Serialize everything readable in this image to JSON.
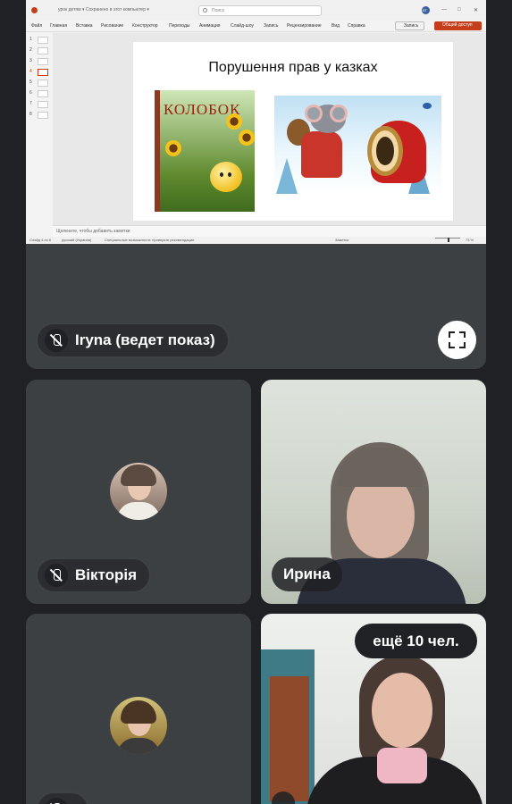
{
  "presentation": {
    "doc_title": "урок детям ▾ Сохранено в этот компьютер ▾",
    "search_placeholder": "Поиск",
    "avatar_initials": "ВТ",
    "window_controls": [
      "—",
      "□",
      "✕"
    ],
    "ribbon_tabs": [
      "Файл",
      "Главная",
      "Вставка",
      "Рисование",
      "Конструктор",
      "Переходы",
      "Анимация",
      "Слайд-шоу",
      "Запись",
      "Рецензирование",
      "Вид",
      "Справка"
    ],
    "record_label": "Запись",
    "share_label": "Общий доступ",
    "slide_numbers": [
      "1",
      "2",
      "3",
      "4",
      "5",
      "6",
      "7",
      "8"
    ],
    "active_slide_index": 3,
    "slide_title": "Порушення прав у казках",
    "book_title": "КОЛОБОК",
    "notes_placeholder": "Щелкните, чтобы добавить заметки",
    "status": {
      "slide_counter": "Слайд 4 из 8",
      "language": "русский (Украина)",
      "accessibility": "Специальные возможности: проверьте рекомендации",
      "notes_button": "Заметки",
      "zoom": "73 %"
    }
  },
  "tiles": {
    "presenter": {
      "label": "Iryna (ведет показ)"
    },
    "participant_1": {
      "name": "Вікторія"
    },
    "participant_2": {
      "name": "Ирина"
    },
    "participant_3": {
      "name": ""
    },
    "participant_4": {
      "name": ""
    },
    "more_participants": "ещё 10 чел."
  },
  "icons": {
    "mic_muted": "mic-off-icon",
    "fullscreen": "fullscreen-icon"
  },
  "colors": {
    "background": "#202124",
    "tile": "#3c4043",
    "powerpoint_accent": "#c43e1c"
  }
}
